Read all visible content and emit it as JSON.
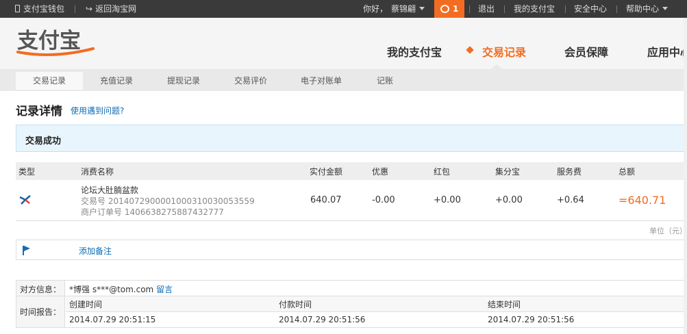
{
  "topbar": {
    "wallet": "支付宝钱包",
    "back_taobao": "返回淘宝网",
    "greeting": "你好，",
    "username": "蔡锦翩",
    "notif_count": "1",
    "logout": "退出",
    "my_alipay": "我的支付宝",
    "security": "安全中心",
    "help": "帮助中心"
  },
  "header": {
    "logo_text": "支付宝",
    "nav": [
      "我的支付宝",
      "交易记录",
      "会员保障",
      "应用中心"
    ],
    "active_nav": "交易记录"
  },
  "subnav": [
    "交易记录",
    "充值记录",
    "提现记录",
    "交易评价",
    "电子对账单",
    "记账"
  ],
  "page": {
    "title": "记录详情",
    "help_link": "使用遇到问题?",
    "status": "交易成功"
  },
  "table": {
    "headers": [
      "类型",
      "消费名称",
      "实付金额",
      "优惠",
      "红包",
      "集分宝",
      "服务费",
      "总额"
    ],
    "row": {
      "name": "论坛大肚腩盆款",
      "trade_no": "交易号 2014072900001000310030053559",
      "order_no": "商户订单号 1406638275887432777",
      "paid": "640.07",
      "discount": "-0.00",
      "red_packet": "+0.00",
      "jifenbao": "+0.00",
      "service_fee": "+0.64",
      "total": "=640.71"
    },
    "unit_note": "单位（元）"
  },
  "remark": {
    "add_label": "添加备注"
  },
  "info": {
    "counterparty_label": "对方信息：",
    "counterparty": "*博强 s***@tom.com",
    "message_link": "留言",
    "time_label": "时间报告：",
    "time_headers": [
      "创建时间",
      "付款时间",
      "结束时间"
    ],
    "times": [
      "2014.07.29 20:51:15",
      "2014.07.29 20:51:56",
      "2014.07.29 20:51:56"
    ]
  },
  "colors": {
    "accent": "#f36c21",
    "link": "#0b6bb5",
    "topbar": "#3a3a3a"
  }
}
